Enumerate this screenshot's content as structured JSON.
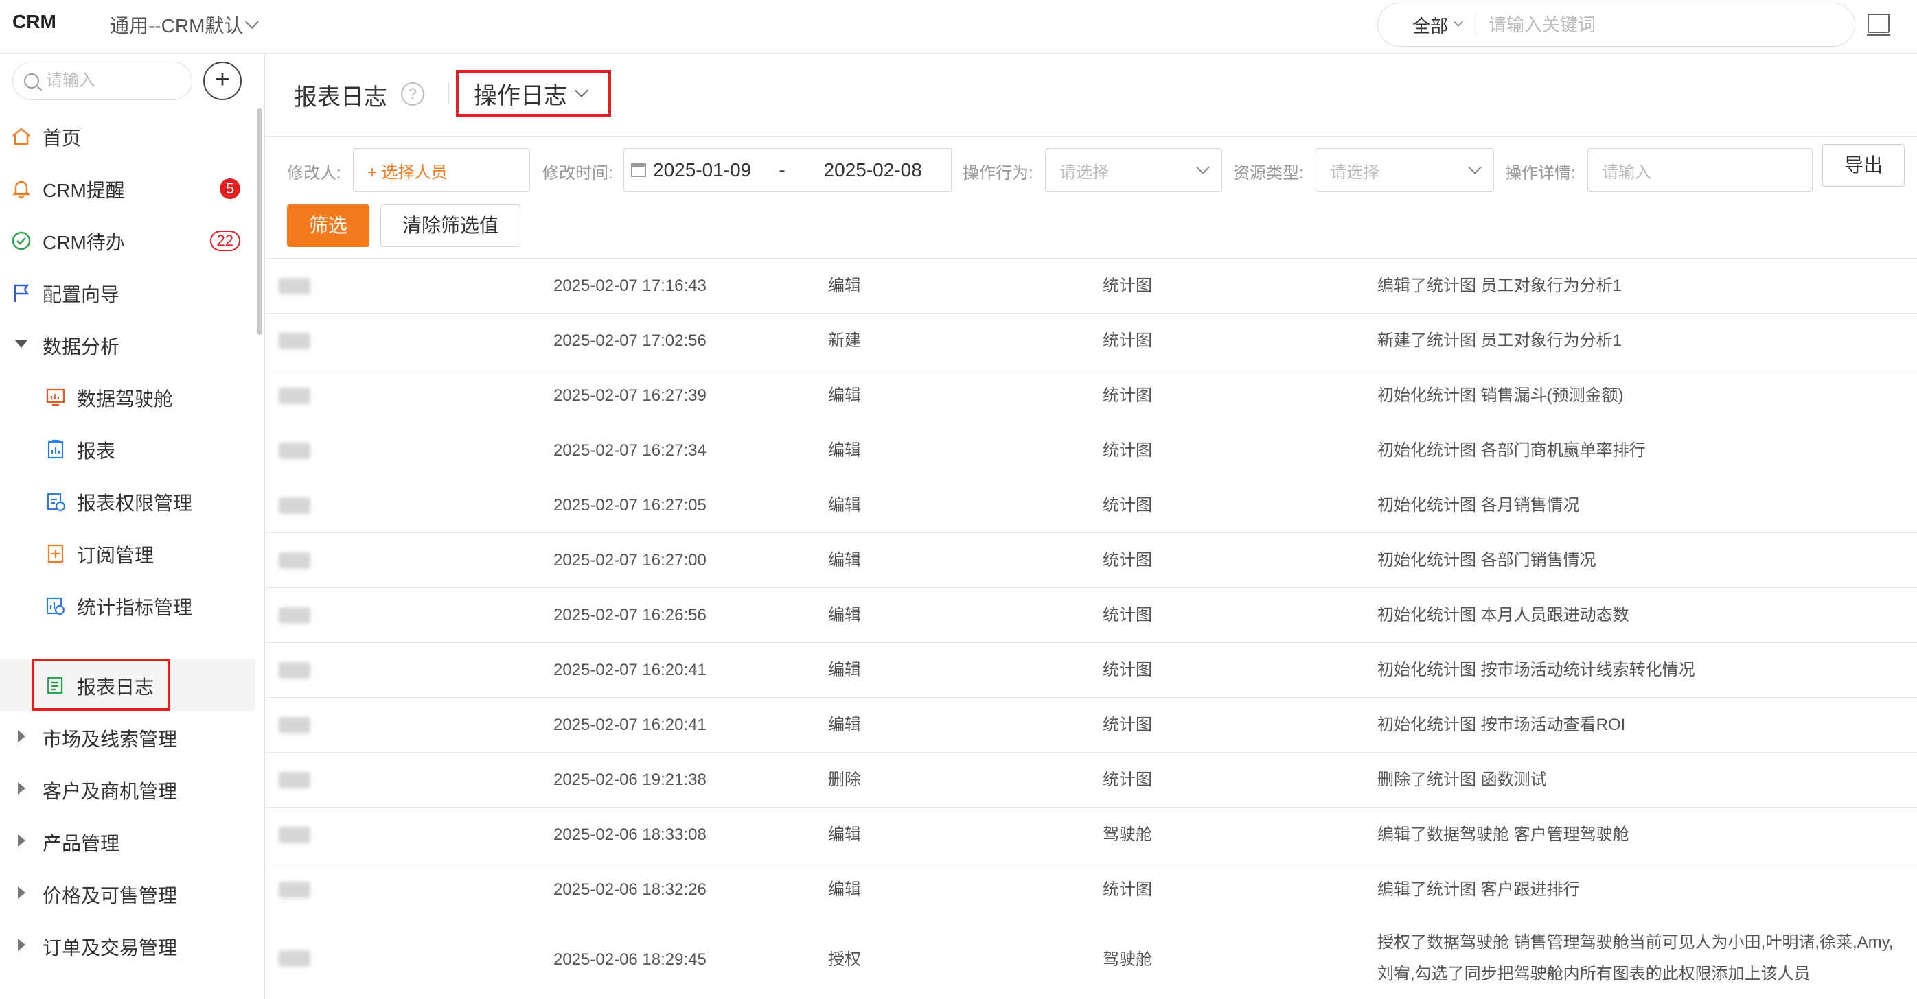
{
  "topbar": {
    "brand": "CRM",
    "scope": "通用--CRM默认",
    "search_scope": "全部",
    "search_placeholder": "请输入关键词"
  },
  "sidebar": {
    "search_placeholder": "请输入",
    "items": [
      {
        "label": "首页",
        "icon": "home-icon"
      },
      {
        "label": "CRM提醒",
        "icon": "bell-icon",
        "badge": "5"
      },
      {
        "label": "CRM待办",
        "icon": "check-circle-icon",
        "badge": "22"
      },
      {
        "label": "配置向导",
        "icon": "flag-icon"
      },
      {
        "label": "数据分析",
        "expanded": true
      },
      {
        "label": "数据驾驶舱",
        "icon": "dashboard-icon"
      },
      {
        "label": "报表",
        "icon": "report-icon"
      },
      {
        "label": "报表权限管理",
        "icon": "report-permission-icon"
      },
      {
        "label": "订阅管理",
        "icon": "subscription-icon"
      },
      {
        "label": "统计指标管理",
        "icon": "metric-icon"
      },
      {
        "label": "报表日志",
        "icon": "log-icon",
        "active": true
      },
      {
        "label": "市场及线索管理"
      },
      {
        "label": "客户及商机管理"
      },
      {
        "label": "产品管理"
      },
      {
        "label": "价格及可售管理"
      },
      {
        "label": "订单及交易管理"
      }
    ]
  },
  "header": {
    "title": "报表日志",
    "help": "?",
    "log_type": "操作日志"
  },
  "filters": {
    "person_label": "修改人:",
    "person_value": "+ 选择人员",
    "time_label": "修改时间:",
    "date_start": "2025-01-09",
    "date_sep": "-",
    "date_end": "2025-02-08",
    "action_label": "操作行为:",
    "action_placeholder": "请选择",
    "resource_label": "资源类型:",
    "resource_placeholder": "请选择",
    "detail_label": "操作详情:",
    "detail_placeholder": "请输入",
    "export": "导出",
    "filter": "筛选",
    "clear": "清除筛选值"
  },
  "logs": [
    {
      "time": "2025-02-07 17:16:43",
      "action": "编辑",
      "resource": "统计图",
      "detail": "编辑了统计图 员工对象行为分析1"
    },
    {
      "time": "2025-02-07 17:02:56",
      "action": "新建",
      "resource": "统计图",
      "detail": "新建了统计图 员工对象行为分析1"
    },
    {
      "time": "2025-02-07 16:27:39",
      "action": "编辑",
      "resource": "统计图",
      "detail": "初始化统计图 销售漏斗(预测金额)"
    },
    {
      "time": "2025-02-07 16:27:34",
      "action": "编辑",
      "resource": "统计图",
      "detail": "初始化统计图 各部门商机赢单率排行"
    },
    {
      "time": "2025-02-07 16:27:05",
      "action": "编辑",
      "resource": "统计图",
      "detail": "初始化统计图 各月销售情况"
    },
    {
      "time": "2025-02-07 16:27:00",
      "action": "编辑",
      "resource": "统计图",
      "detail": "初始化统计图 各部门销售情况"
    },
    {
      "time": "2025-02-07 16:26:56",
      "action": "编辑",
      "resource": "统计图",
      "detail": "初始化统计图 本月人员跟进动态数"
    },
    {
      "time": "2025-02-07 16:20:41",
      "action": "编辑",
      "resource": "统计图",
      "detail": "初始化统计图 按市场活动统计线索转化情况"
    },
    {
      "time": "2025-02-07 16:20:41",
      "action": "编辑",
      "resource": "统计图",
      "detail": "初始化统计图 按市场活动查看ROI"
    },
    {
      "time": "2025-02-06 19:21:38",
      "action": "删除",
      "resource": "统计图",
      "detail": "删除了统计图 函数测试"
    },
    {
      "time": "2025-02-06 18:33:08",
      "action": "编辑",
      "resource": "驾驶舱",
      "detail": "编辑了数据驾驶舱 客户管理驾驶舱"
    },
    {
      "time": "2025-02-06 18:32:26",
      "action": "编辑",
      "resource": "统计图",
      "detail": "编辑了统计图 客户跟进排行"
    },
    {
      "time": "2025-02-06 18:29:45",
      "action": "授权",
      "resource": "驾驶舱",
      "detail": "授权了数据驾驶舱 销售管理驾驶舱当前可见人为小田,叶明诸,徐莱,Amy,刘宥,勾选了同步把驾驶舱内所有图表的此权限添加上该人员"
    }
  ]
}
